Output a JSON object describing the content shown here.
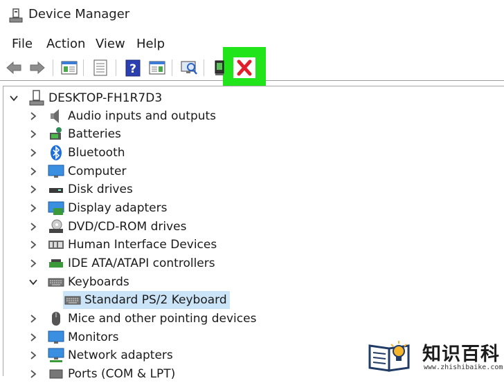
{
  "window": {
    "title": "Device Manager"
  },
  "menu": [
    "File",
    "Action",
    "View",
    "Help"
  ],
  "toolbar": {
    "buttons": [
      "back-icon",
      "forward-icon",
      "properties-icon",
      "show-hide-console-tree-icon",
      "help-icon",
      "action-pane-icon",
      "scan-hardware-icon",
      "update-driver-icon",
      "uninstall-device-icon"
    ],
    "highlight_color": "#22e41b"
  },
  "tree": {
    "root": "DESKTOP-FH1R7D3",
    "items": [
      {
        "label": "Audio inputs and outputs",
        "icon": "speaker-icon",
        "expanded": false
      },
      {
        "label": "Batteries",
        "icon": "battery-icon",
        "expanded": false
      },
      {
        "label": "Bluetooth",
        "icon": "bluetooth-icon",
        "expanded": false
      },
      {
        "label": "Computer",
        "icon": "monitor-icon",
        "expanded": false
      },
      {
        "label": "Disk drives",
        "icon": "disk-drive-icon",
        "expanded": false
      },
      {
        "label": "Display adapters",
        "icon": "display-adapter-icon",
        "expanded": false
      },
      {
        "label": "DVD/CD-ROM drives",
        "icon": "dvd-drive-icon",
        "expanded": false
      },
      {
        "label": "Human Interface Devices",
        "icon": "hid-icon",
        "expanded": false
      },
      {
        "label": "IDE ATA/ATAPI controllers",
        "icon": "ide-controller-icon",
        "expanded": false
      },
      {
        "label": "Keyboards",
        "icon": "keyboard-icon",
        "expanded": true
      },
      {
        "label": "Standard PS/2 Keyboard",
        "icon": "keyboard-icon",
        "child": true,
        "selected": true
      },
      {
        "label": "Mice and other pointing devices",
        "icon": "mouse-icon",
        "expanded": false
      },
      {
        "label": "Monitors",
        "icon": "monitor-icon",
        "expanded": false
      },
      {
        "label": "Network adapters",
        "icon": "network-adapter-icon",
        "expanded": false
      },
      {
        "label": "Ports (COM & LPT)",
        "icon": "port-icon",
        "expanded": false
      }
    ]
  },
  "watermark": {
    "brand": "知识百科",
    "url": "www.zhishibaike.com"
  },
  "colors": {
    "selection": "#cce4f7",
    "accent_blue": "#1e6fd9",
    "uninstall_red": "#e0202a"
  }
}
